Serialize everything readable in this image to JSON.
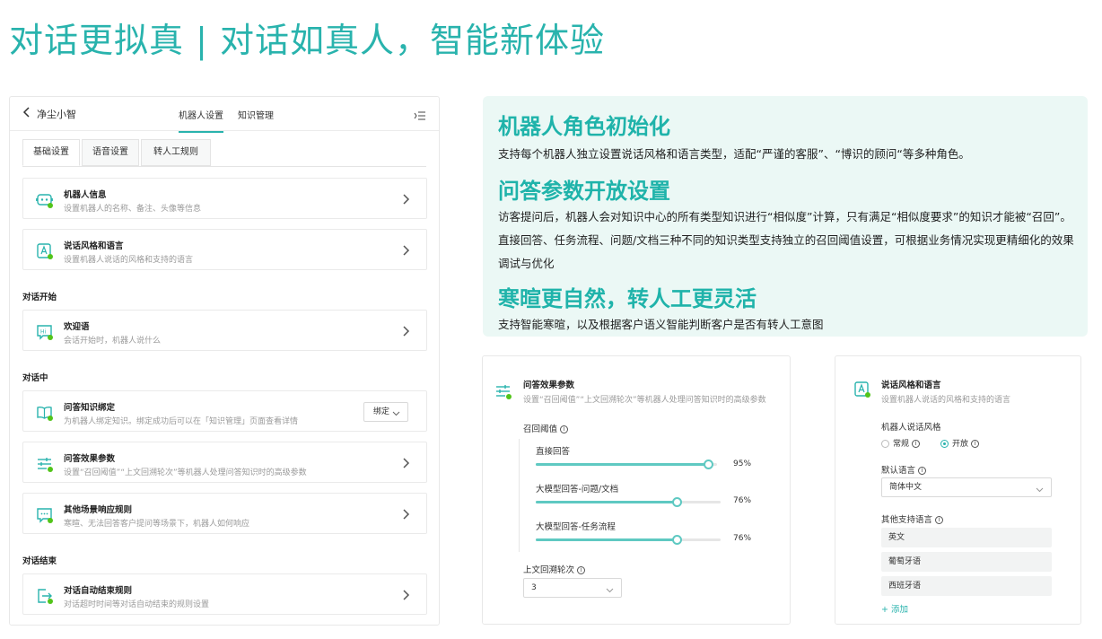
{
  "hero_title": "对话更拟真 | 对话如真人，智能新体验",
  "left_panel": {
    "back_icon": "chevron-left-icon",
    "title": "净尘小智",
    "tabs": [
      {
        "label": "机器人设置",
        "active": true
      },
      {
        "label": "知识管理",
        "active": false
      }
    ],
    "menu_icon": "collapse-menu-icon",
    "subtabs": [
      {
        "label": "基础设置",
        "active": true
      },
      {
        "label": "语音设置",
        "active": false
      },
      {
        "label": "转人工规则",
        "active": false
      }
    ],
    "cards_top": [
      {
        "icon": "robot-icon",
        "title": "机器人信息",
        "desc": "设置机器人的名称、备注、头像等信息"
      },
      {
        "icon": "language-style-icon",
        "title": "说话风格和语言",
        "desc": "设置机器人说话的风格和支持的语言"
      }
    ],
    "section_start": "对话开始",
    "cards_start": [
      {
        "icon": "greeting-hi-icon",
        "title": "欢迎语",
        "desc": "会话开始时，机器人说什么"
      }
    ],
    "section_middle": "对话中",
    "cards_middle": [
      {
        "icon": "book-icon",
        "title": "问答知识绑定",
        "desc": "为机器人绑定知识。绑定成功后可以在「知识管理」页面查看详情",
        "button": "绑定"
      },
      {
        "icon": "sliders-icon",
        "title": "问答效果参数",
        "desc": "设置“召回阈值”“上文回溯轮次”等机器人处理问答知识时的高级参数"
      },
      {
        "icon": "chat-bubble-icon",
        "title": "其他场景响应规则",
        "desc": "寒暄、无法回答客户提问等场景下，机器人如何响应"
      }
    ],
    "section_end": "对话结束",
    "cards_end": [
      {
        "icon": "exit-icon",
        "title": "对话自动结束规则",
        "desc": "对话超时时间等对话自动结束的规则设置"
      }
    ]
  },
  "info_box": {
    "h1": "机器人角色初始化",
    "p1": "支持每个机器人独立设置说话风格和语言类型，适配“严谨的客服”、“博识的顾问“等多种角色。",
    "h2": "问答参数开放设置",
    "p2": "访客提问后，机器人会对知识中心的所有类型知识进行“相似度”计算，只有满足“相似度要求”的知识才能被“召回”。直接回答、任务流程、问题/文档三种不同的知识类型支持独立的召回阈值设置，可根据业务情况实现更精细化的效果调试与优化",
    "h3": "寒暄更自然，转人工更灵活",
    "p3": "支持智能寒暄，以及根据客户语义智能判断客户是否有转人工意图"
  },
  "qa_params": {
    "icon": "sliders-icon",
    "title": "问答效果参数",
    "desc": "设置“召回阈值”“上文回溯轮次”等机器人处理问答知识时的高级参数",
    "threshold_label": "召回阈值",
    "sliders": [
      {
        "label": "直接回答",
        "value": 0.95,
        "display": "95%"
      },
      {
        "label": "大模型回答-问题/文档",
        "value": 0.76,
        "display": "76%"
      },
      {
        "label": "大模型回答-任务流程",
        "value": 0.76,
        "display": "76%"
      }
    ],
    "rounds_label": "上文回溯轮次",
    "rounds_value": "3"
  },
  "style_lang": {
    "icon": "language-style-icon",
    "title": "说话风格和语言",
    "desc": "设置机器人说话的风格和支持的语言",
    "style_label": "机器人说话风格",
    "style_options": [
      {
        "label": "常规",
        "selected": false
      },
      {
        "label": "开放",
        "selected": true
      }
    ],
    "default_lang_label": "默认语言",
    "default_lang_value": "简体中文",
    "other_lang_label": "其他支持语言",
    "other_langs": [
      "英文",
      "葡萄牙语",
      "西班牙语"
    ],
    "add_label": "+ 添加"
  },
  "colors": {
    "accent": "#29b3ad",
    "status_green": "#52c41a",
    "info_bg": "#ebf8f5"
  }
}
